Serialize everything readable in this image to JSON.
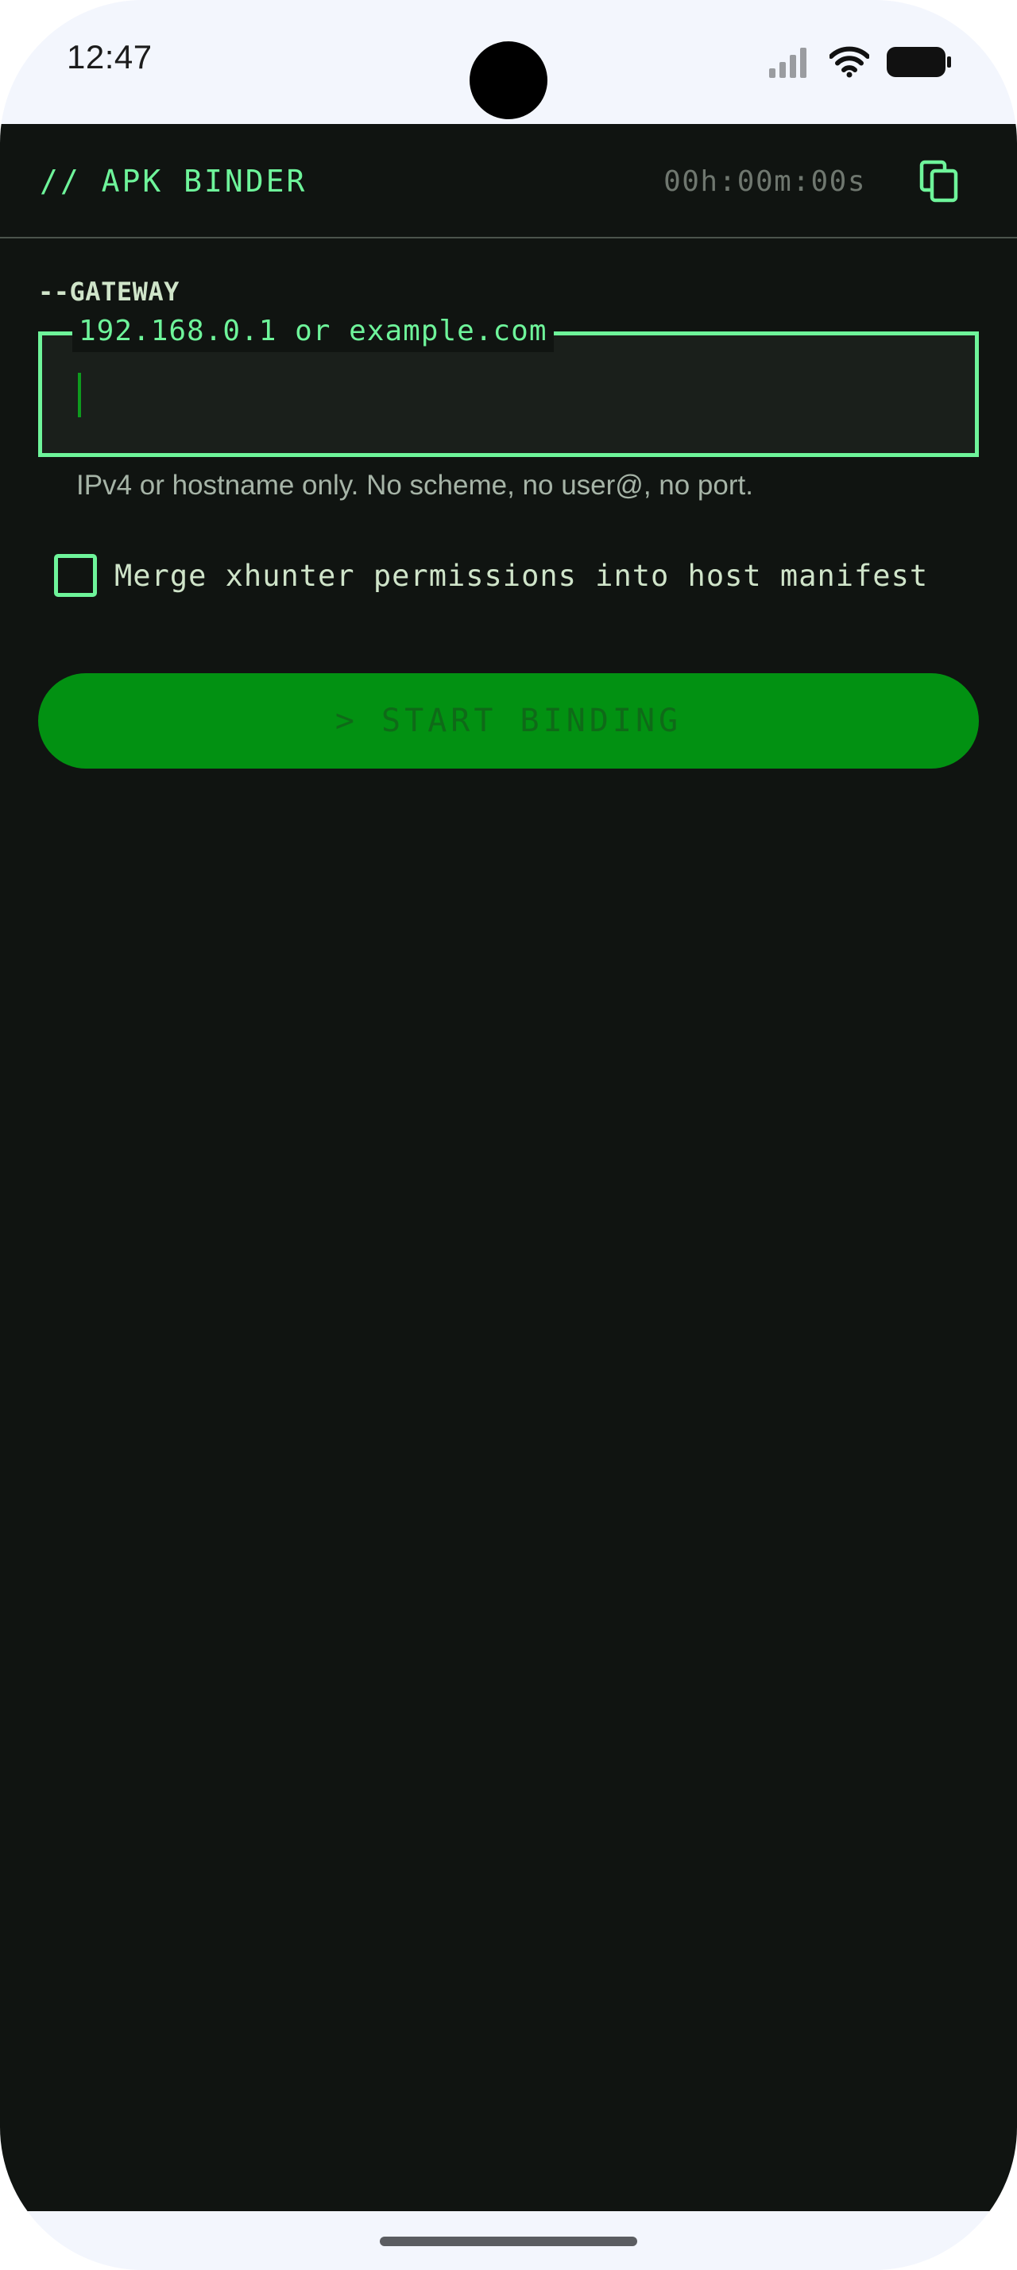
{
  "status_bar": {
    "time": "12:47",
    "icons": [
      "cellular-signal-icon",
      "wifi-icon",
      "battery-icon"
    ]
  },
  "header": {
    "title": "// APK BINDER",
    "timer": "00h:00m:00s",
    "copy_icon": "copy-icon"
  },
  "gateway": {
    "section_label": "--GATEWAY",
    "placeholder": "192.168.0.1 or example.com",
    "value": "",
    "helper": "IPv4 or hostname only. No scheme, no user@, no port."
  },
  "merge_option": {
    "label": "Merge xhunter permissions into host manifest",
    "checked": false
  },
  "actions": {
    "start_label": "> START BINDING",
    "start_enabled": false
  },
  "colors": {
    "background": "#101411",
    "accent": "#6ef49a",
    "button": "#029112",
    "button_text": "#0f6a18",
    "muted_text": "#a6b4a7",
    "timer_text": "#6f776f",
    "system_bars": "#f3f6fd"
  }
}
